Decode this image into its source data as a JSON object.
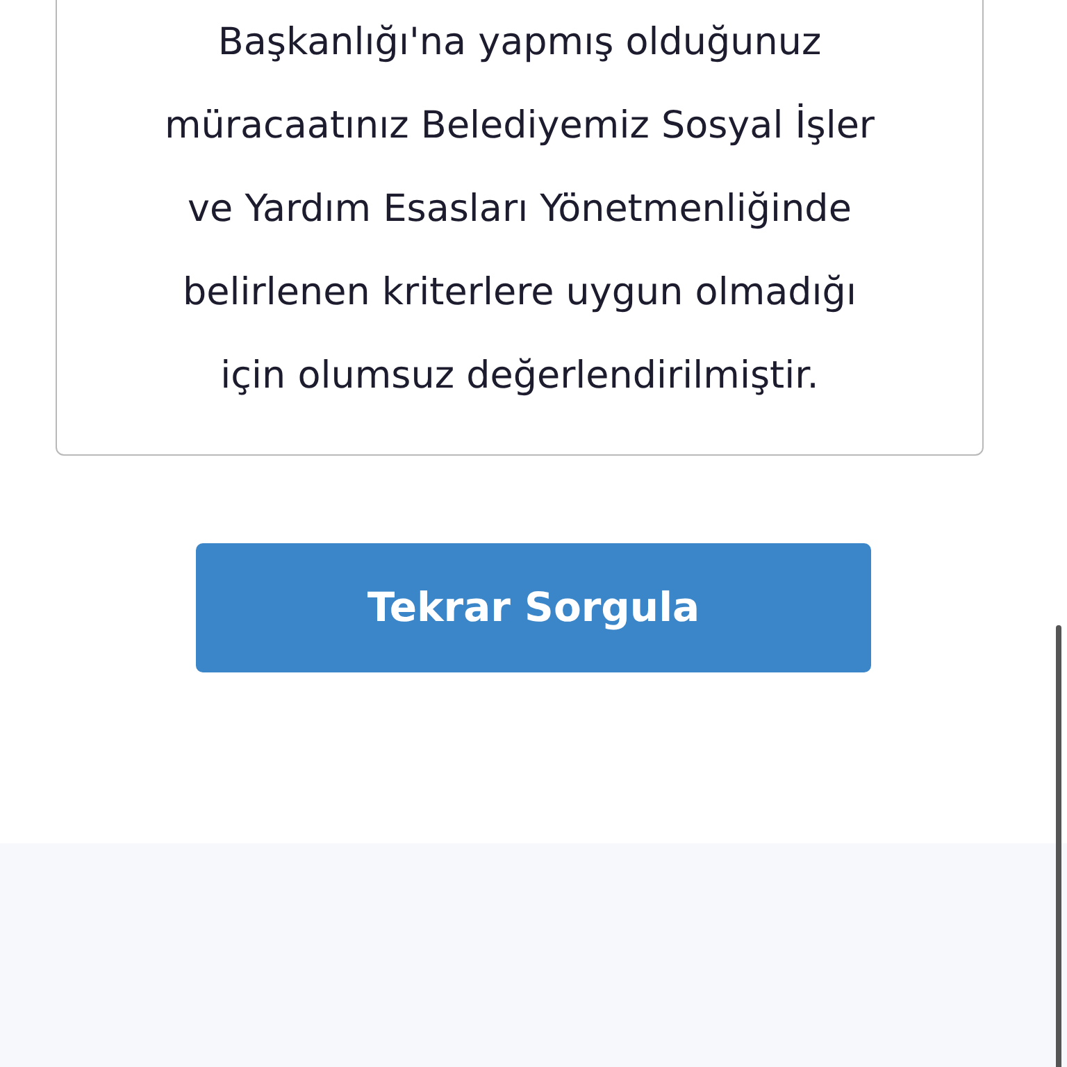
{
  "message": {
    "lines": [
      "Başkanlığı'na yapmış olduğunuz",
      "müracaatınız Belediyemiz Sosyal İşler",
      "ve Yardım Esasları Yönetmenliğinde",
      "belirlenen kriterlere uygun olmadığı",
      "için olumsuz değerlendirilmiştir."
    ]
  },
  "button": {
    "label": "Tekrar Sorgula"
  }
}
